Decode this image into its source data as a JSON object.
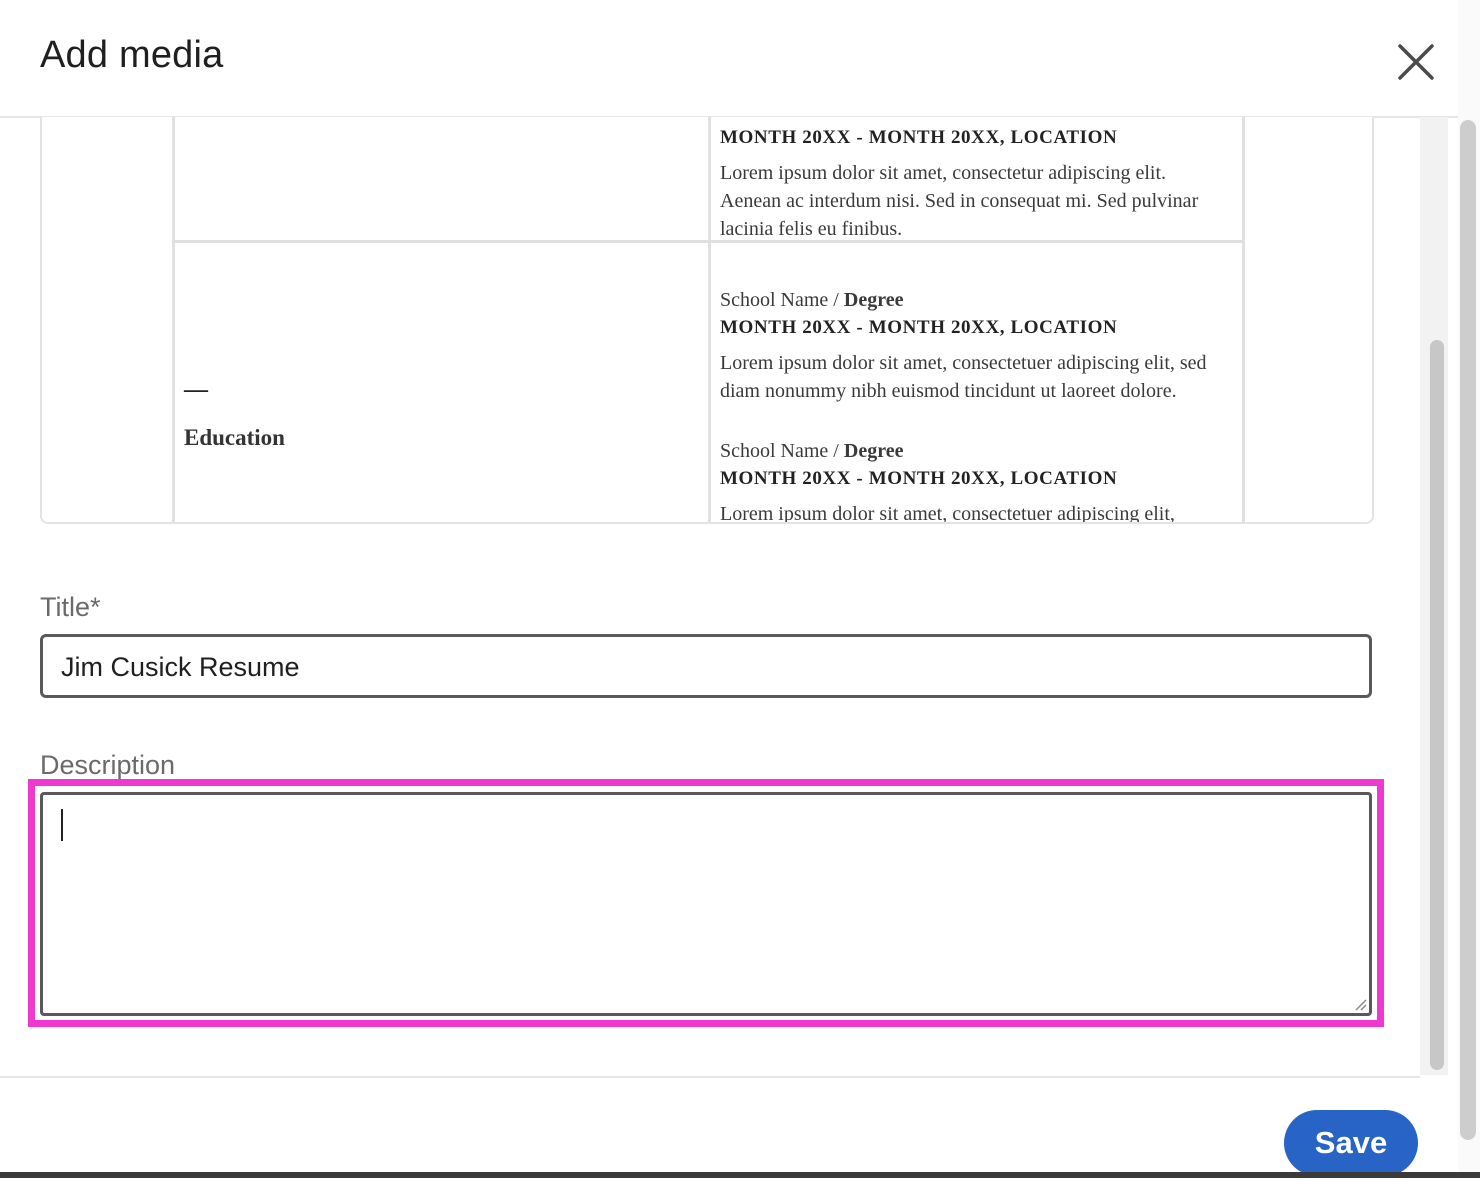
{
  "dialog": {
    "title": "Add media",
    "close_icon": "close-icon"
  },
  "preview": {
    "experience_partial": {
      "dates": "MONTH 20XX - MONTH 20XX, LOCATION",
      "lines": [
        "Lorem ipsum dolor sit amet, consectetur adipiscing elit.",
        "Aenean ac interdum nisi. Sed in consequat mi. Sed pulvinar",
        "lacinia felis eu finibus."
      ]
    },
    "education": {
      "dash": "—",
      "heading": "Education",
      "entries": [
        {
          "school": "School Name / ",
          "degree": "Degree",
          "dates": "MONTH 20XX - MONTH 20XX, LOCATION",
          "lines": [
            "Lorem ipsum dolor sit amet, consectetuer adipiscing elit, sed",
            "diam nonummy nibh euismod tincidunt ut laoreet dolore."
          ]
        },
        {
          "school": "School Name / ",
          "degree": "Degree",
          "dates": "MONTH 20XX - MONTH 20XX, LOCATION",
          "lines": [
            "Lorem ipsum dolor sit amet, consectetuer adipiscing elit,"
          ]
        }
      ]
    }
  },
  "form": {
    "title_label": "Title",
    "required_marker": "*",
    "title_value": "Jim Cusick Resume",
    "description_label": "Description",
    "description_value": ""
  },
  "footer": {
    "save_label": "Save"
  },
  "colors": {
    "primary": "#2764c5",
    "highlight": "#ee38cf"
  }
}
